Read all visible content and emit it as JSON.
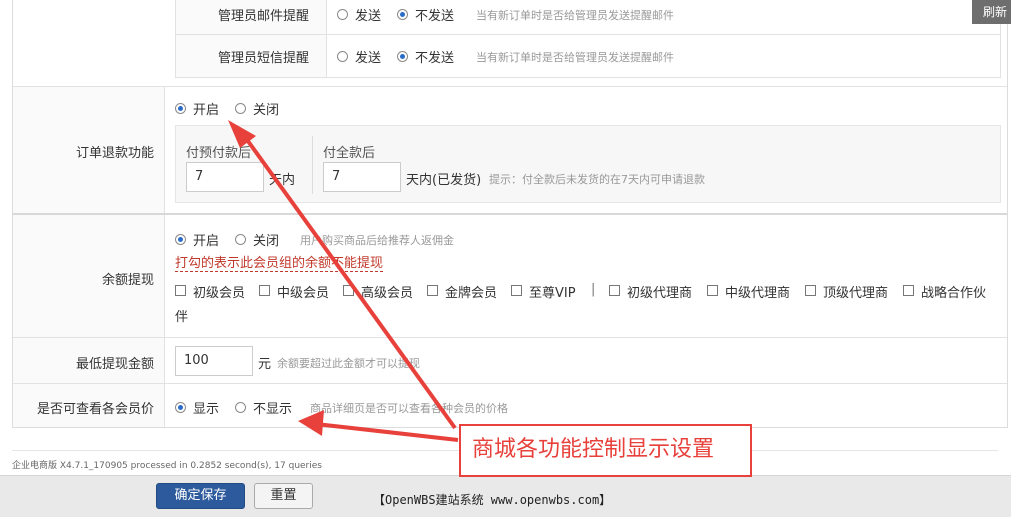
{
  "top_right_button": "刷新",
  "admin_email": {
    "label": "管理员邮件提醒",
    "opt_send": "发送",
    "opt_no_send": "不发送",
    "hint": "当有新订单时是否给管理员发送提醒邮件"
  },
  "admin_sms": {
    "label": "管理员短信提醒",
    "opt_send": "发送",
    "opt_no_send": "不发送",
    "hint": "当有新订单时是否给管理员发送提醒邮件"
  },
  "refund": {
    "label": "订单退款功能",
    "opt_on": "开启",
    "opt_off": "关闭",
    "prepay_label": "付预付款后",
    "prepay_value": "7",
    "prepay_unit": "天内",
    "full_label": "付全款后",
    "full_value": "7",
    "full_unit": "天内(已发货)",
    "hint": "提示：付全款后未发货的在7天内可申请退款"
  },
  "balance": {
    "label": "余额提现",
    "opt_on": "开启",
    "opt_off": "关闭",
    "hint": "用户购买商品后给推荐人返佣金",
    "note": "打勾的表示此会员组的余额不能提现",
    "groups": [
      "初级会员",
      "中级会员",
      "高级会员",
      "金牌会员",
      "至尊VIP",
      "初级代理商",
      "中级代理商",
      "顶级代理商",
      "战略合作伙"
    ],
    "separator": "|",
    "wrap": "伴"
  },
  "min_withdraw": {
    "label": "最低提现金额",
    "value": "100",
    "unit": "元",
    "hint": "余额要超过此金额才可以提现"
  },
  "member_price": {
    "label": "是否可查看各会员价",
    "opt_show": "显示",
    "opt_hide": "不显示",
    "hint": "商品详细页是否可以查看各种会员的价格"
  },
  "annotation": "商城各功能控制显示设置",
  "footer": {
    "version": "企业电商版 X4.7.1_170905 processed in 0.2852 second(s), 17 queries"
  },
  "bottom_bar": {
    "save": "确定保存",
    "reset": "重置",
    "brand": "【OpenWBS建站系统 www.openwbs.com】"
  },
  "colors": {
    "accent": "#2c6cc9",
    "note_red": "#c0392b",
    "arrow": "#e8413b",
    "save_bg": "#2d5a9c"
  }
}
